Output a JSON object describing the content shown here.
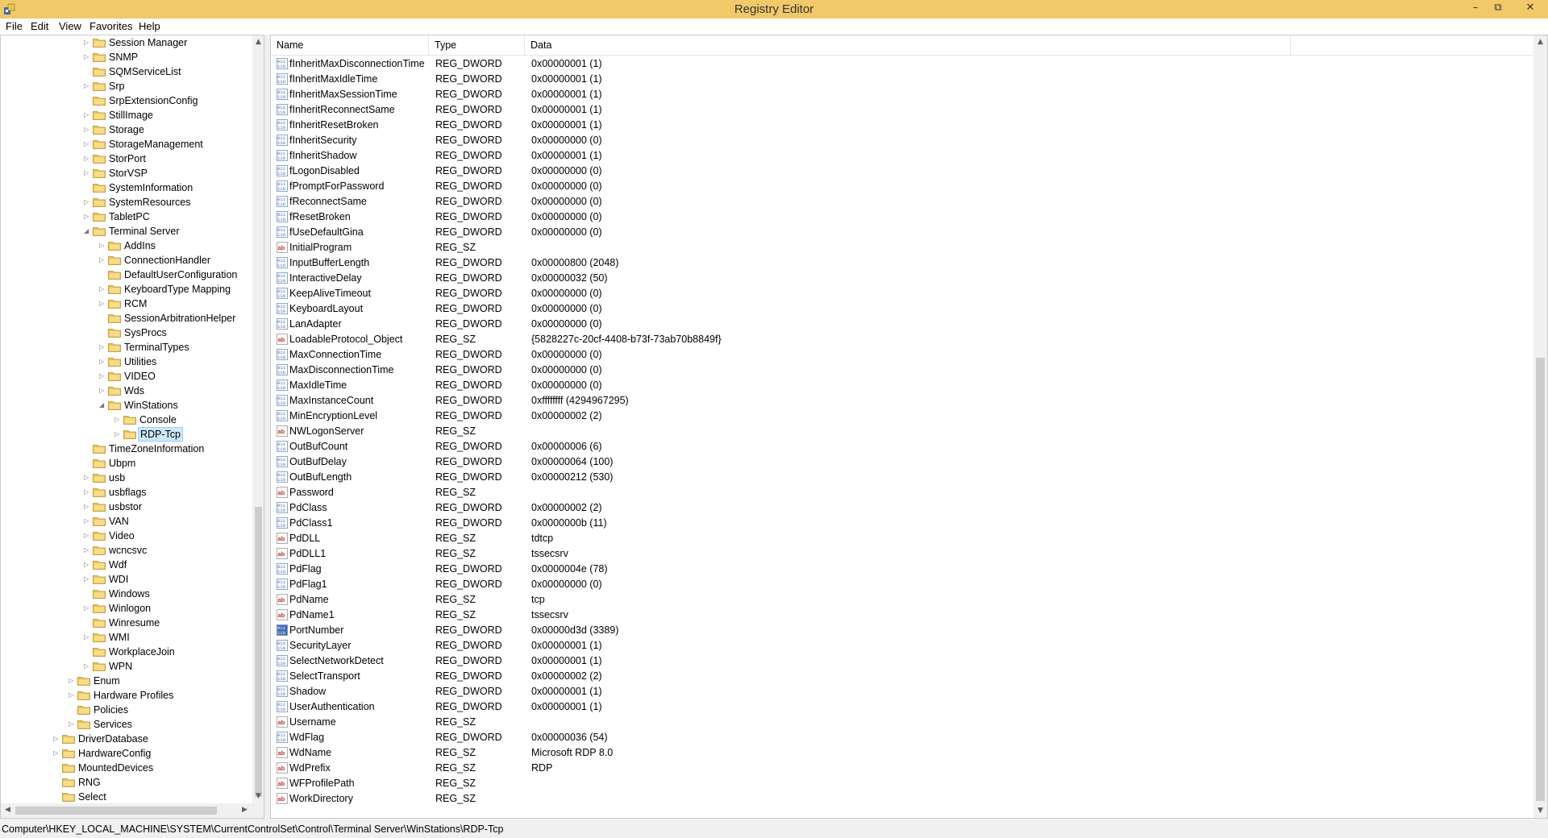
{
  "window": {
    "title": "Registry Editor",
    "controls": {
      "minimize": "–",
      "restore": "⧉",
      "close": "✕"
    }
  },
  "menu": [
    {
      "label": "File"
    },
    {
      "label": "Edit"
    },
    {
      "label": "View"
    },
    {
      "label": "Favorites"
    },
    {
      "label": "Help"
    }
  ],
  "tree": {
    "items": [
      {
        "label": "Session Manager",
        "level": 2,
        "expander": "collapsed"
      },
      {
        "label": "SNMP",
        "level": 2,
        "expander": "collapsed"
      },
      {
        "label": "SQMServiceList",
        "level": 2,
        "expander": "none"
      },
      {
        "label": "Srp",
        "level": 2,
        "expander": "collapsed"
      },
      {
        "label": "SrpExtensionConfig",
        "level": 2,
        "expander": "none"
      },
      {
        "label": "StillImage",
        "level": 2,
        "expander": "collapsed"
      },
      {
        "label": "Storage",
        "level": 2,
        "expander": "collapsed"
      },
      {
        "label": "StorageManagement",
        "level": 2,
        "expander": "collapsed"
      },
      {
        "label": "StorPort",
        "level": 2,
        "expander": "collapsed"
      },
      {
        "label": "StorVSP",
        "level": 2,
        "expander": "collapsed"
      },
      {
        "label": "SystemInformation",
        "level": 2,
        "expander": "none"
      },
      {
        "label": "SystemResources",
        "level": 2,
        "expander": "collapsed"
      },
      {
        "label": "TabletPC",
        "level": 2,
        "expander": "collapsed"
      },
      {
        "label": "Terminal Server",
        "level": 2,
        "expander": "expanded"
      },
      {
        "label": "AddIns",
        "level": 3,
        "expander": "collapsed"
      },
      {
        "label": "ConnectionHandler",
        "level": 3,
        "expander": "collapsed"
      },
      {
        "label": "DefaultUserConfiguration",
        "level": 3,
        "expander": "none"
      },
      {
        "label": "KeyboardType Mapping",
        "level": 3,
        "expander": "collapsed"
      },
      {
        "label": "RCM",
        "level": 3,
        "expander": "collapsed"
      },
      {
        "label": "SessionArbitrationHelper",
        "level": 3,
        "expander": "none"
      },
      {
        "label": "SysProcs",
        "level": 3,
        "expander": "none"
      },
      {
        "label": "TerminalTypes",
        "level": 3,
        "expander": "collapsed"
      },
      {
        "label": "Utilities",
        "level": 3,
        "expander": "collapsed"
      },
      {
        "label": "VIDEO",
        "level": 3,
        "expander": "collapsed"
      },
      {
        "label": "Wds",
        "level": 3,
        "expander": "collapsed"
      },
      {
        "label": "WinStations",
        "level": 3,
        "expander": "expanded"
      },
      {
        "label": "Console",
        "level": 4,
        "expander": "collapsed"
      },
      {
        "label": "RDP-Tcp",
        "level": 4,
        "expander": "collapsed",
        "selected": true
      },
      {
        "label": "TimeZoneInformation",
        "level": 2,
        "expander": "none"
      },
      {
        "label": "Ubpm",
        "level": 2,
        "expander": "none"
      },
      {
        "label": "usb",
        "level": 2,
        "expander": "collapsed"
      },
      {
        "label": "usbflags",
        "level": 2,
        "expander": "collapsed"
      },
      {
        "label": "usbstor",
        "level": 2,
        "expander": "collapsed"
      },
      {
        "label": "VAN",
        "level": 2,
        "expander": "collapsed"
      },
      {
        "label": "Video",
        "level": 2,
        "expander": "collapsed"
      },
      {
        "label": "wcncsvc",
        "level": 2,
        "expander": "collapsed"
      },
      {
        "label": "Wdf",
        "level": 2,
        "expander": "collapsed"
      },
      {
        "label": "WDI",
        "level": 2,
        "expander": "collapsed"
      },
      {
        "label": "Windows",
        "level": 2,
        "expander": "none"
      },
      {
        "label": "Winlogon",
        "level": 2,
        "expander": "collapsed"
      },
      {
        "label": "Winresume",
        "level": 2,
        "expander": "none"
      },
      {
        "label": "WMI",
        "level": 2,
        "expander": "collapsed"
      },
      {
        "label": "WorkplaceJoin",
        "level": 2,
        "expander": "none"
      },
      {
        "label": "WPN",
        "level": 2,
        "expander": "collapsed"
      },
      {
        "label": "Enum",
        "level": 1,
        "expander": "collapsed"
      },
      {
        "label": "Hardware Profiles",
        "level": 1,
        "expander": "collapsed"
      },
      {
        "label": "Policies",
        "level": 1,
        "expander": "none"
      },
      {
        "label": "Services",
        "level": 1,
        "expander": "collapsed"
      },
      {
        "label": "DriverDatabase",
        "level": 0,
        "expander": "collapsed"
      },
      {
        "label": "HardwareConfig",
        "level": 0,
        "expander": "collapsed"
      },
      {
        "label": "MountedDevices",
        "level": 0,
        "expander": "none"
      },
      {
        "label": "RNG",
        "level": 0,
        "expander": "none"
      },
      {
        "label": "Select",
        "level": 0,
        "expander": "none"
      }
    ]
  },
  "list": {
    "columns": {
      "name": "Name",
      "type": "Type",
      "data": "Data"
    },
    "rows": [
      {
        "name": "fInheritMaxDisconnectionTime",
        "type": "REG_DWORD",
        "data": "0x00000001 (1)"
      },
      {
        "name": "fInheritMaxIdleTime",
        "type": "REG_DWORD",
        "data": "0x00000001 (1)"
      },
      {
        "name": "fInheritMaxSessionTime",
        "type": "REG_DWORD",
        "data": "0x00000001 (1)"
      },
      {
        "name": "fInheritReconnectSame",
        "type": "REG_DWORD",
        "data": "0x00000001 (1)"
      },
      {
        "name": "fInheritResetBroken",
        "type": "REG_DWORD",
        "data": "0x00000001 (1)"
      },
      {
        "name": "fInheritSecurity",
        "type": "REG_DWORD",
        "data": "0x00000000 (0)"
      },
      {
        "name": "fInheritShadow",
        "type": "REG_DWORD",
        "data": "0x00000001 (1)"
      },
      {
        "name": "fLogonDisabled",
        "type": "REG_DWORD",
        "data": "0x00000000 (0)"
      },
      {
        "name": "fPromptForPassword",
        "type": "REG_DWORD",
        "data": "0x00000000 (0)"
      },
      {
        "name": "fReconnectSame",
        "type": "REG_DWORD",
        "data": "0x00000000 (0)"
      },
      {
        "name": "fResetBroken",
        "type": "REG_DWORD",
        "data": "0x00000000 (0)"
      },
      {
        "name": "fUseDefaultGina",
        "type": "REG_DWORD",
        "data": "0x00000000 (0)"
      },
      {
        "name": "InitialProgram",
        "type": "REG_SZ",
        "data": ""
      },
      {
        "name": "InputBufferLength",
        "type": "REG_DWORD",
        "data": "0x00000800 (2048)"
      },
      {
        "name": "InteractiveDelay",
        "type": "REG_DWORD",
        "data": "0x00000032 (50)"
      },
      {
        "name": "KeepAliveTimeout",
        "type": "REG_DWORD",
        "data": "0x00000000 (0)"
      },
      {
        "name": "KeyboardLayout",
        "type": "REG_DWORD",
        "data": "0x00000000 (0)"
      },
      {
        "name": "LanAdapter",
        "type": "REG_DWORD",
        "data": "0x00000000 (0)"
      },
      {
        "name": "LoadableProtocol_Object",
        "type": "REG_SZ",
        "data": "{5828227c-20cf-4408-b73f-73ab70b8849f}"
      },
      {
        "name": "MaxConnectionTime",
        "type": "REG_DWORD",
        "data": "0x00000000 (0)"
      },
      {
        "name": "MaxDisconnectionTime",
        "type": "REG_DWORD",
        "data": "0x00000000 (0)"
      },
      {
        "name": "MaxIdleTime",
        "type": "REG_DWORD",
        "data": "0x00000000 (0)"
      },
      {
        "name": "MaxInstanceCount",
        "type": "REG_DWORD",
        "data": "0xffffffff (4294967295)"
      },
      {
        "name": "MinEncryptionLevel",
        "type": "REG_DWORD",
        "data": "0x00000002 (2)"
      },
      {
        "name": "NWLogonServer",
        "type": "REG_SZ",
        "data": ""
      },
      {
        "name": "OutBufCount",
        "type": "REG_DWORD",
        "data": "0x00000006 (6)"
      },
      {
        "name": "OutBufDelay",
        "type": "REG_DWORD",
        "data": "0x00000064 (100)"
      },
      {
        "name": "OutBufLength",
        "type": "REG_DWORD",
        "data": "0x00000212 (530)"
      },
      {
        "name": "Password",
        "type": "REG_SZ",
        "data": ""
      },
      {
        "name": "PdClass",
        "type": "REG_DWORD",
        "data": "0x00000002 (2)"
      },
      {
        "name": "PdClass1",
        "type": "REG_DWORD",
        "data": "0x0000000b (11)"
      },
      {
        "name": "PdDLL",
        "type": "REG_SZ",
        "data": "tdtcp"
      },
      {
        "name": "PdDLL1",
        "type": "REG_SZ",
        "data": "tssecsrv"
      },
      {
        "name": "PdFlag",
        "type": "REG_DWORD",
        "data": "0x0000004e (78)"
      },
      {
        "name": "PdFlag1",
        "type": "REG_DWORD",
        "data": "0x00000000 (0)"
      },
      {
        "name": "PdName",
        "type": "REG_SZ",
        "data": "tcp"
      },
      {
        "name": "PdName1",
        "type": "REG_SZ",
        "data": "tssecsrv"
      },
      {
        "name": "PortNumber",
        "type": "REG_DWORD",
        "data": "0x00000d3d (3389)",
        "highlighted": true
      },
      {
        "name": "SecurityLayer",
        "type": "REG_DWORD",
        "data": "0x00000001 (1)"
      },
      {
        "name": "SelectNetworkDetect",
        "type": "REG_DWORD",
        "data": "0x00000001 (1)"
      },
      {
        "name": "SelectTransport",
        "type": "REG_DWORD",
        "data": "0x00000002 (2)"
      },
      {
        "name": "Shadow",
        "type": "REG_DWORD",
        "data": "0x00000001 (1)"
      },
      {
        "name": "UserAuthentication",
        "type": "REG_DWORD",
        "data": "0x00000001 (1)"
      },
      {
        "name": "Username",
        "type": "REG_SZ",
        "data": ""
      },
      {
        "name": "WdFlag",
        "type": "REG_DWORD",
        "data": "0x00000036 (54)"
      },
      {
        "name": "WdName",
        "type": "REG_SZ",
        "data": "Microsoft RDP 8.0"
      },
      {
        "name": "WdPrefix",
        "type": "REG_SZ",
        "data": "RDP"
      },
      {
        "name": "WFProfilePath",
        "type": "REG_SZ",
        "data": ""
      },
      {
        "name": "WorkDirectory",
        "type": "REG_SZ",
        "data": ""
      }
    ]
  },
  "statusbar": {
    "path": "Computer\\HKEY_LOCAL_MACHINE\\SYSTEM\\CurrentControlSet\\Control\\Terminal Server\\WinStations\\RDP-Tcp"
  },
  "colors": {
    "titlebar": "#f2c969",
    "selection": "#cce8ff",
    "folder": "#e8c25a",
    "dword_icon": "#3d6bb3",
    "sz_icon": "#c0392b"
  }
}
